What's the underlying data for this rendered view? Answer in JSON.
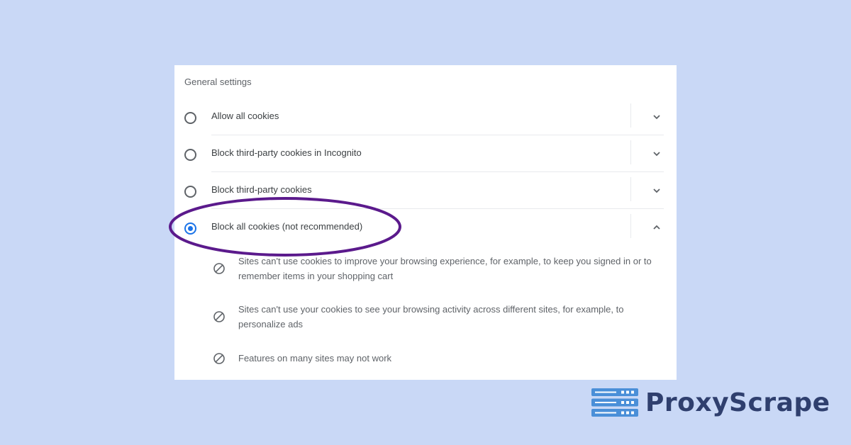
{
  "settings": {
    "section_title": "General settings",
    "options": [
      {
        "label": "Allow all cookies",
        "selected": false,
        "expanded": false,
        "expand_icon": "chevron-down-icon"
      },
      {
        "label": "Block third-party cookies in Incognito",
        "selected": false,
        "expanded": false,
        "expand_icon": "chevron-down-icon"
      },
      {
        "label": "Block third-party cookies",
        "selected": false,
        "expanded": false,
        "expand_icon": "chevron-down-icon"
      },
      {
        "label": "Block all cookies (not recommended)",
        "selected": true,
        "expanded": true,
        "expand_icon": "chevron-up-icon"
      }
    ],
    "details": [
      {
        "icon": "block-icon",
        "text": "Sites can't use cookies to improve your browsing experience, for example, to keep you signed in or to remember items in your shopping cart"
      },
      {
        "icon": "block-icon",
        "text": "Sites can't use your cookies to see your browsing activity across different sites, for example, to personalize ads"
      },
      {
        "icon": "block-icon",
        "text": "Features on many sites may not work"
      }
    ]
  },
  "annotation": {
    "highlight_color": "#5b1a8c",
    "target": "Block all cookies (not recommended)"
  },
  "brand": {
    "name": "ProxyScrape",
    "logo_icon": "server-stack-icon",
    "logo_color": "#4a8fd8",
    "text_color": "#2f3f6e"
  },
  "colors": {
    "background": "#c9d8f6",
    "panel": "#ffffff",
    "accent": "#1a73e8"
  }
}
